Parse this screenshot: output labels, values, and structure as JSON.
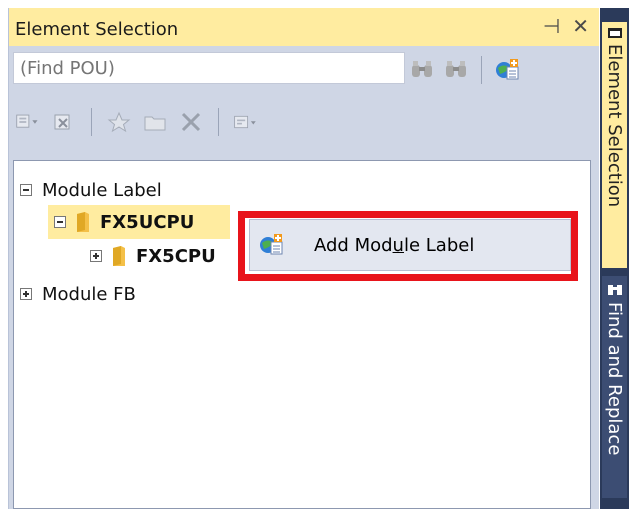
{
  "panel": {
    "title": "Element Selection",
    "pin_glyph": "⊣",
    "close_glyph": "✕"
  },
  "search": {
    "placeholder": "(Find POU)"
  },
  "tree": {
    "items": [
      {
        "label": "Module Label",
        "expander": "minus"
      },
      {
        "label": "FX5UCPU",
        "expander": "minus",
        "selected": true
      },
      {
        "label": "FX5CPU",
        "expander": "plus"
      },
      {
        "label": "Module FB",
        "expander": "plus"
      }
    ]
  },
  "context_menu": {
    "item_label_pre": "Add Mod",
    "item_label_accel": "u",
    "item_label_post": "le Label"
  },
  "dock": {
    "tabs": [
      {
        "label": "Element Selection",
        "active": true
      },
      {
        "label": "Find and Replace",
        "active": false
      }
    ]
  },
  "colors": {
    "title_bg": "#ffeca0",
    "panel_bg": "#cfd6e5",
    "highlight_red": "#e8141b",
    "dock_bg": "#2b3a5a"
  }
}
